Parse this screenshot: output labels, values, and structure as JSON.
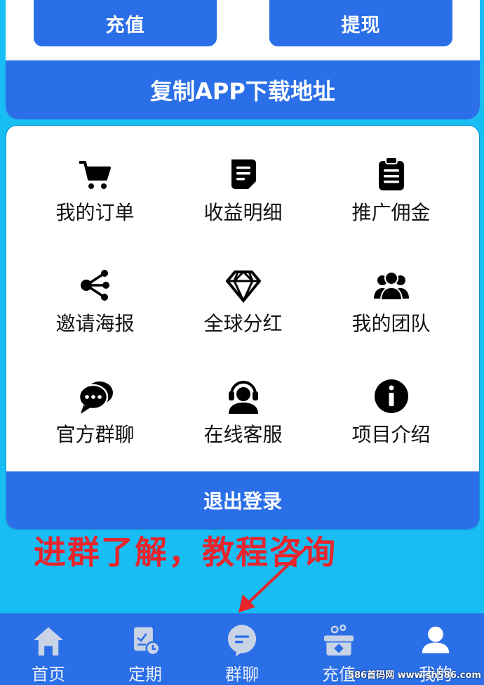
{
  "top": {
    "recharge_label": "充值",
    "withdraw_label": "提现",
    "copy_app_label": "复制APP下载地址"
  },
  "menu": {
    "items": [
      {
        "label": "我的订单",
        "icon": "cart-icon"
      },
      {
        "label": "收益明细",
        "icon": "document-icon"
      },
      {
        "label": "推广佣金",
        "icon": "clipboard-icon"
      },
      {
        "label": "邀请海报",
        "icon": "share-icon"
      },
      {
        "label": "全球分红",
        "icon": "diamond-icon"
      },
      {
        "label": "我的团队",
        "icon": "team-icon"
      },
      {
        "label": "官方群聊",
        "icon": "chat-bubbles-icon"
      },
      {
        "label": "在线客服",
        "icon": "headset-icon"
      },
      {
        "label": "项目介绍",
        "icon": "info-icon"
      }
    ],
    "logout_label": "退出登录"
  },
  "annotation": {
    "text": "进群了解，教程咨询",
    "color": "#e8242c"
  },
  "nav": {
    "items": [
      {
        "label": "首页",
        "icon": "home-icon"
      },
      {
        "label": "定期",
        "icon": "schedule-icon"
      },
      {
        "label": "群聊",
        "icon": "chat-icon"
      },
      {
        "label": "充值",
        "icon": "recharge-icon"
      },
      {
        "label": "我的",
        "icon": "user-icon",
        "active": true
      }
    ]
  },
  "watermark": "586首码网 www.sh586.com",
  "colors": {
    "background": "#18bdf3",
    "primary": "#2b6fe8",
    "card": "#ffffff"
  }
}
